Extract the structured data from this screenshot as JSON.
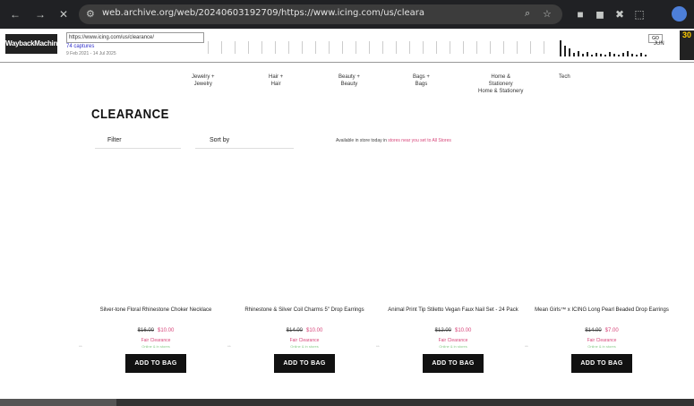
{
  "browser": {
    "url": "web.archive.org/web/20240603192709/https://www.icing.com/us/clearance/",
    "nav_back": "←",
    "nav_forward": "→",
    "nav_close": "✕"
  },
  "wayback": {
    "logo_line1": "INTERNET ARCHIVE",
    "logo_line2": "WaybackMachine",
    "url": "https://www.icing.com/us/clearance/",
    "captures": "74 captures",
    "range": "9 Feb 2021 - 14 Jul 2025",
    "go_label": "GO",
    "months": [
      "JUN"
    ],
    "year": "30"
  },
  "nav": {
    "menu": [
      {
        "line1": "Jewelry +",
        "line2": "Jewelry"
      },
      {
        "line1": "Hair +",
        "line2": "Hair"
      },
      {
        "line1": "Beauty +",
        "line2": "Beauty"
      },
      {
        "line1": "Bags +",
        "line2": "Bags"
      },
      {
        "line1": "Home &",
        "line2": "Stationery",
        "line3": "Home & Stationery"
      },
      {
        "line1": "Tech",
        "line2": ""
      }
    ]
  },
  "page": {
    "title": "CLEARANCE",
    "filter_label": "Filter",
    "sort_label": "Sort by",
    "pickup_text": "Available in store today in",
    "pickup_link": "stores near you set to All Stores"
  },
  "products": [
    {
      "name": "Silver-tone Floral Rhinestone Choker Necklace",
      "was": "$16.00",
      "now": "$10.00",
      "promo": "Fair Clearance",
      "avail": "Online & in stores",
      "button": "ADD TO BAG"
    },
    {
      "name": "Rhinestone & Silver Coil Charms 5\" Drop Earrings",
      "was": "$14.00",
      "now": "$10.00",
      "promo": "Fair Clearance",
      "avail": "Online & in stores",
      "button": "ADD TO BAG"
    },
    {
      "name": "Animal Print Tip Stiletto Vegan Faux Nail Set - 24 Pack",
      "was": "$12.00",
      "now": "$10.00",
      "promo": "Fair Clearance",
      "avail": "Online & in stores",
      "button": "ADD TO BAG"
    },
    {
      "name": "Mean Girls™ x ICING Long Pearl Beaded Drop Earrings",
      "was": "$14.00",
      "now": "$7.00",
      "promo": "Fair Clearance",
      "avail": "Online & in stores",
      "button": "ADD TO BAG"
    }
  ],
  "colors": {
    "accent": "#d7467a",
    "button": "#111111",
    "chrome": "#202124"
  }
}
